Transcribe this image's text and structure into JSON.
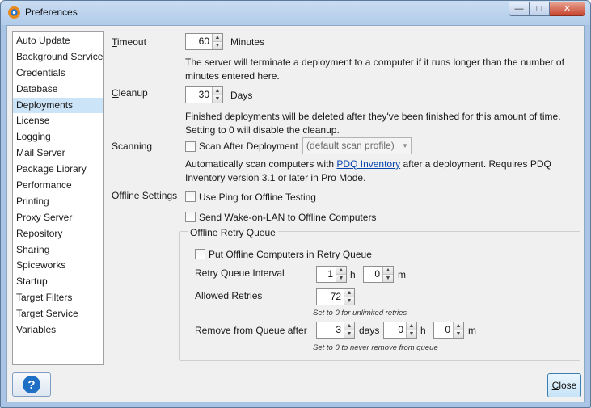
{
  "window": {
    "title": "Preferences",
    "min_glyph": "—",
    "max_glyph": "□",
    "close_glyph": "✕"
  },
  "sidebar": {
    "selected_index": 4,
    "items": [
      "Auto Update",
      "Background Service",
      "Credentials",
      "Database",
      "Deployments",
      "License",
      "Logging",
      "Mail Server",
      "Package Library",
      "Performance",
      "Printing",
      "Proxy Server",
      "Repository",
      "Sharing",
      "Spiceworks",
      "Startup",
      "Target Filters",
      "Target Service",
      "Variables"
    ]
  },
  "timeout": {
    "label_key": "T",
    "label_rest": "imeout",
    "value": "60",
    "unit": "Minutes",
    "description": "The server will terminate a deployment to a computer if it runs longer than the number of minutes entered here."
  },
  "cleanup": {
    "label_key": "C",
    "label_rest": "leanup",
    "value": "30",
    "unit": "Days",
    "description": "Finished deployments will be deleted after they've been finished for this amount of time. Setting to 0 will disable the cleanup."
  },
  "scanning": {
    "label": "Scanning",
    "checkbox_label": "Scan After Deployment",
    "checked": false,
    "profile_value": "(default scan profile)",
    "desc_before": "Automatically scan computers with ",
    "link_text": "PDQ Inventory",
    "desc_after": " after a deployment. Requires PDQ Inventory version 3.1 or later in Pro Mode."
  },
  "offline": {
    "label": "Offline Settings",
    "use_ping_label": "Use Ping for Offline Testing",
    "wake_on_lan_label": "Send Wake-on-LAN to Offline Computers"
  },
  "retry_queue": {
    "title": "Offline Retry Queue",
    "put_label": "Put Offline Computers in Retry Queue",
    "interval_label": "Retry Queue Interval",
    "interval_hours": "1",
    "hours_unit": "h",
    "interval_minutes": "0",
    "minutes_unit": "m",
    "allowed_label": "Allowed Retries",
    "allowed_value": "72",
    "allowed_hint": "Set to 0 for unlimited retries",
    "remove_label": "Remove from Queue after",
    "remove_days": "3",
    "days_unit": "days",
    "remove_hours": "0",
    "remove_minutes": "0",
    "remove_hint": "Set to 0 to never remove from queue"
  },
  "footer": {
    "help_glyph": "?",
    "close_key": "C",
    "close_rest": "lose"
  },
  "colors": {
    "selection": "#cce4f7",
    "link": "#0645ad",
    "help_circle": "#1f6fc5"
  }
}
